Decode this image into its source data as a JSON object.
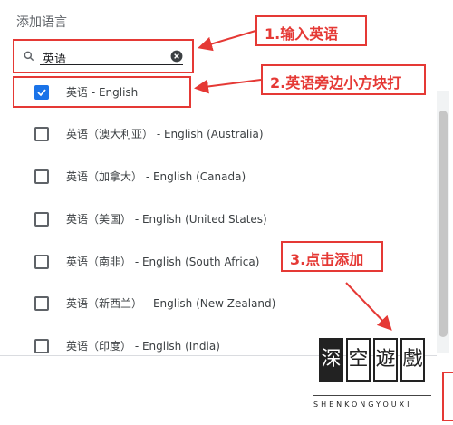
{
  "dialog": {
    "title": "添加语言",
    "search": {
      "value": "英语"
    },
    "items": [
      {
        "label": "英语 - English",
        "checked": true
      },
      {
        "label": "英语（澳大利亚） - English (Australia)",
        "checked": false
      },
      {
        "label": "英语（加拿大） - English (Canada)",
        "checked": false
      },
      {
        "label": "英语（美国） - English (United States)",
        "checked": false
      },
      {
        "label": "英语（南非） - English (South Africa)",
        "checked": false
      },
      {
        "label": "英语（新西兰） - English (New Zealand)",
        "checked": false
      },
      {
        "label": "英语（印度） - English (India)",
        "checked": false
      }
    ]
  },
  "annotations": {
    "step1": "1.输入英语",
    "step2": "2.英语旁边小方块打",
    "step3": "3.点击添加"
  },
  "watermark": {
    "chars": [
      "深",
      "空",
      "遊",
      "戲"
    ],
    "subtitle": "SHENKONGYOUXI"
  },
  "colors": {
    "accent": "#1a73e8",
    "annotation_red": "#e53935"
  },
  "icons": {
    "search": "search-icon",
    "clear": "clear-icon",
    "checkmark": "checkmark-icon"
  }
}
